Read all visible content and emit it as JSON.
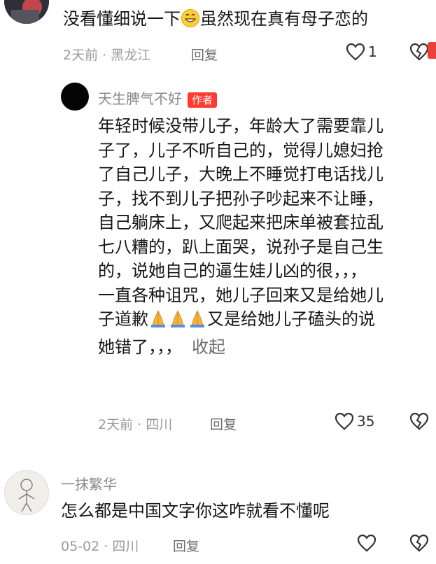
{
  "comment_top": {
    "text_before": "没看懂细说一下",
    "text_after": "虽然现在真有母子恋的",
    "time_location": "2天前 · 黑龙江",
    "reply_label": "回复",
    "like_count": "1"
  },
  "reply": {
    "username": "天生脾气不好",
    "badge": "作者",
    "lines": [
      "年轻时候没带儿子，年龄大了需要靠儿",
      "子了，儿子不听自己的，觉得儿媳妇抢",
      "了自己儿子，大晚上不睡觉打电话找儿",
      "子，找不到儿子把孙子吵起来不让睡，",
      "自己躺床上，又爬起来把床单被套拉乱",
      "七八糟的，趴上面哭，说孙子是自己生",
      "的，说她自己的逼生娃儿凶的很，，，",
      "一直各种诅咒，她儿子回来又是给她儿"
    ],
    "line9_before": "子道歉",
    "line9_after": "又是给她儿子磕头的说",
    "line10": "她错了，，，",
    "collapse_label": "收起",
    "time_location": "2天前 · 四川",
    "reply_label": "回复",
    "like_count": "35"
  },
  "comment_bottom": {
    "username": "一抹繁华",
    "text": "怎么都是中国文字你这咋就看不懂呢",
    "time_location": "05-02 · 四川",
    "reply_label": "回复"
  },
  "colors": {
    "badge_red": "#ff3b30",
    "meta_gray": "#9a9a9a"
  },
  "icons": [
    "heart-outline-icon",
    "broken-heart-icon",
    "praying-hands-icon",
    "grin-emoji-icon"
  ]
}
